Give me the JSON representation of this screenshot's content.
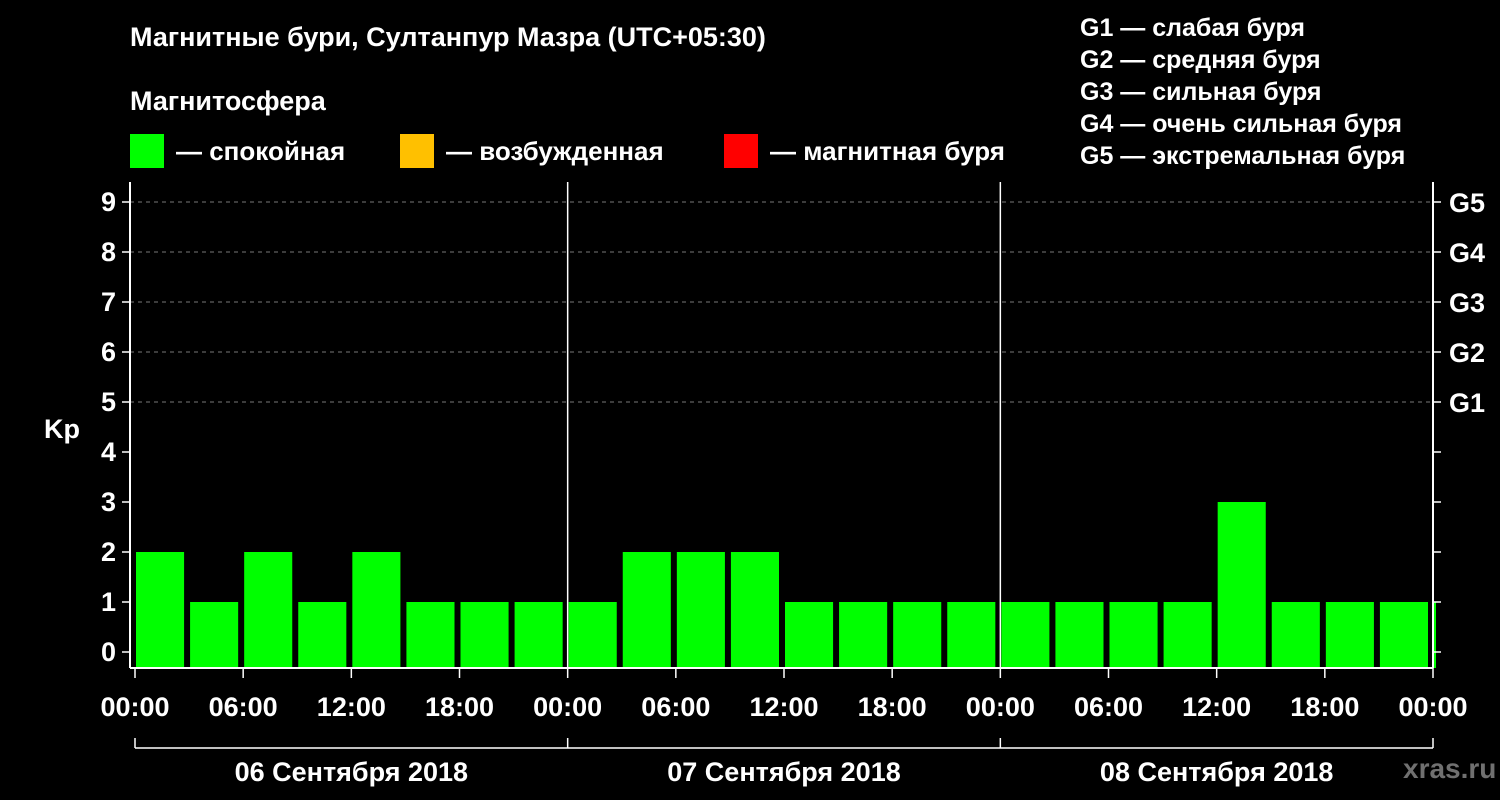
{
  "title": "Магнитные бури, Султанпур Мазра (UTC+05:30)",
  "magnetosphere_label": "Магнитосфера",
  "legend": [
    {
      "color": "#00ff00",
      "label": "— спокойная"
    },
    {
      "color": "#ffc000",
      "label": "— возбужденная"
    },
    {
      "color": "#ff0000",
      "label": "— магнитная буря"
    }
  ],
  "storm_scale": [
    "G1 — слабая буря",
    "G2 — средняя буря",
    "G3 — сильная буря",
    "G4 — очень сильная буря",
    "G5 — экстремальная буря"
  ],
  "watermark": "xras.ru",
  "chart_data": {
    "type": "bar",
    "ylabel": "Kp",
    "ylim": [
      0,
      9
    ],
    "yticks": [
      0,
      1,
      2,
      3,
      4,
      5,
      6,
      7,
      8,
      9
    ],
    "right_axis": [
      {
        "kp": 5,
        "label": "G1"
      },
      {
        "kp": 6,
        "label": "G2"
      },
      {
        "kp": 7,
        "label": "G3"
      },
      {
        "kp": 8,
        "label": "G4"
      },
      {
        "kp": 9,
        "label": "G5"
      }
    ],
    "xticks": [
      "00:00",
      "06:00",
      "12:00",
      "18:00",
      "00:00",
      "06:00",
      "12:00",
      "18:00",
      "00:00",
      "06:00",
      "12:00",
      "18:00",
      "00:00"
    ],
    "days": [
      "06 Сентября 2018",
      "07 Сентября 2018",
      "08 Сентября 2018"
    ],
    "bar_color": "#00ff00",
    "values": [
      2,
      1,
      2,
      1,
      2,
      1,
      1,
      1,
      1,
      2,
      2,
      2,
      1,
      1,
      1,
      1,
      1,
      1,
      1,
      1,
      3,
      1,
      1,
      1,
      1
    ]
  }
}
